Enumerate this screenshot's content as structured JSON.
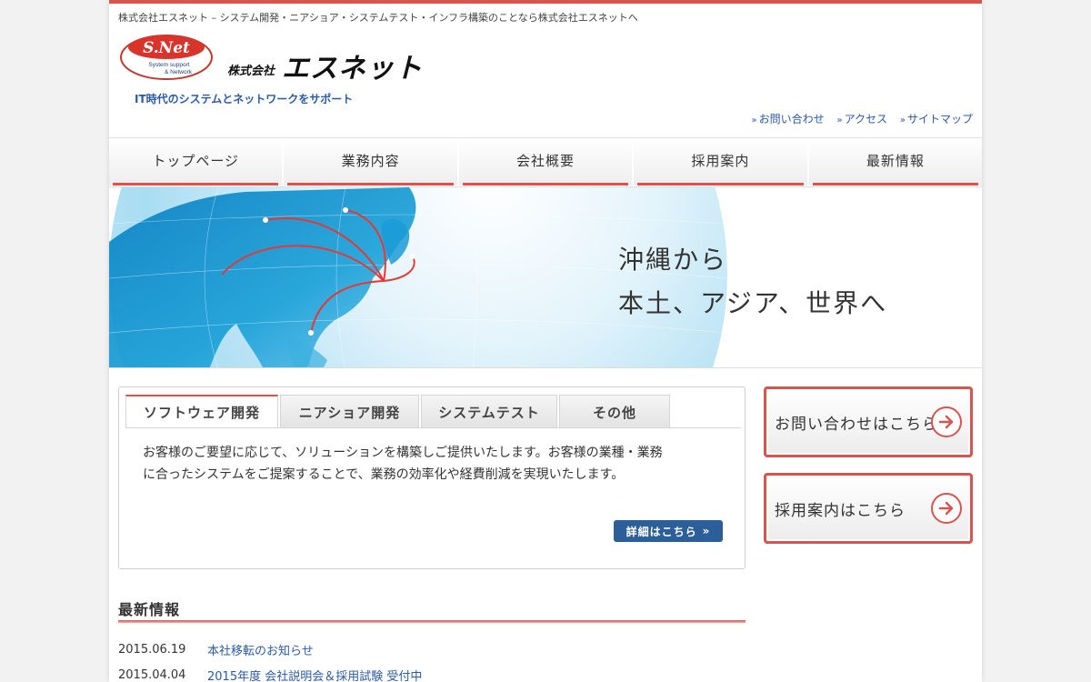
{
  "header": {
    "tagline": "株式会社エスネット – システム開発・ニアショア・システムテスト・インフラ構築のことなら株式会社エスネットへ",
    "logo_text": "S.Net",
    "logo_sub1": "System support",
    "logo_sub2": "& Network",
    "company_prefix": "株式会社",
    "company_name": "エスネット",
    "catchphrase": "IT時代のシステムとネットワークをサポート",
    "util_links": [
      {
        "arrow": "»",
        "label": "お問い合わせ"
      },
      {
        "arrow": "»",
        "label": "アクセス"
      },
      {
        "arrow": "»",
        "label": "サイトマップ"
      }
    ]
  },
  "nav": {
    "items": [
      {
        "label": "トップページ"
      },
      {
        "label": "業務内容"
      },
      {
        "label": "会社概要"
      },
      {
        "label": "採用案内"
      },
      {
        "label": "最新情報"
      }
    ]
  },
  "hero": {
    "line1": "沖縄から",
    "line2": "本土、アジア、世界へ"
  },
  "tabs": {
    "items": [
      {
        "label": "ソフトウェア開発"
      },
      {
        "label": "ニアショア開発"
      },
      {
        "label": "システムテスト"
      },
      {
        "label": "その他"
      }
    ],
    "active": "ソフトウェア開発",
    "content_line1": "お客様のご要望に応じて、ソリューションを構築しご提供いたします。お客様の業種・業務",
    "content_line2": "に合ったシステムをご提案することで、業務の効率化や経費削減を実現いたします。",
    "more_label": "詳細はこちら",
    "more_chevron": "»"
  },
  "side": {
    "contact_label": "お問い合わせはこちら",
    "recruit_label": "採用案内はこちら"
  },
  "news": {
    "heading": "最新情報",
    "items": [
      {
        "date": "2015.06.19",
        "title": "本社移転のお知らせ"
      },
      {
        "date": "2015.04.04",
        "title": "2015年度 会社説明会＆採用試験 受付中"
      }
    ]
  },
  "colors": {
    "accent": "#d9534f",
    "link": "#2a5aa8",
    "button": "#2c5f99"
  }
}
